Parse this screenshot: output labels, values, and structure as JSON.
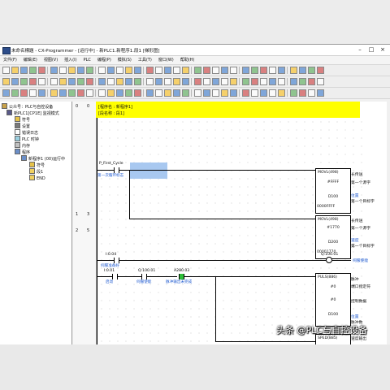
{
  "window": {
    "title": "未命名標題 - CX-Programmer - [运行中] - 新PLC1.新程序1.段1 [梯形图]"
  },
  "menu": [
    "文件(F)",
    "编辑(E)",
    "视图(V)",
    "插入(I)",
    "PLC",
    "编程(P)",
    "模拟(S)",
    "工具(T)",
    "窗口(W)",
    "帮助(H)"
  ],
  "tree": {
    "items": [
      "公众号：PLC与自控设备",
      "新PLC1[CP1E] 监视模式",
      "符号",
      "设置",
      "错误日志",
      "PLC 时钟",
      "内存",
      "程序",
      "新程序1 (00)运行中",
      "符号",
      "段1",
      "END"
    ]
  },
  "ladder": {
    "header": {
      "program_name": "[程序名 : 新程序1]",
      "section_name": "[段名称 : 段1]"
    },
    "rung_numbers": [
      "0",
      "0",
      "1",
      "3",
      "2",
      "5"
    ],
    "rung0": {
      "contact_op": "P_First_Cycle",
      "contact_comment": "第一次循环标志",
      "mov1": {
        "name": "MOVL(498)",
        "src": "#FFFF",
        "dst": "D100",
        "val": "0000FFFF"
      },
      "mov1_desc": [
        "长传送",
        "第一个源字",
        "位置",
        "第一个目标字"
      ],
      "mov2": {
        "name": "MOVL(498)",
        "src": "#1770",
        "dst": "D200",
        "val": "00001770"
      },
      "mov2_desc": [
        "长传送",
        "第一个源字",
        "速度",
        "第一个目标字"
      ]
    },
    "rung1": {
      "contact_op": "I:0.04",
      "contact_comment": "伺服准备好",
      "coil_op": "Q:100.01",
      "coil_comment": "伺服使能"
    },
    "rung2": {
      "c1_op": "I:0.01",
      "c1_comment": "启动",
      "c2_op": "Q:100.01",
      "c2_comment": "伺服使能",
      "c3_op": "A280.03",
      "c3_comment": "脉冲输出未完成",
      "puls": {
        "name": "PULS(886)",
        "p1": "#0",
        "p2": "#0",
        "p3": "D100"
      },
      "puls_desc": [
        "脉冲",
        "端口指定符",
        "控制数据",
        "位置",
        "脉冲数"
      ],
      "sped": {
        "name": "SPED(885)",
        "p1": "#0",
        "p2": "#0111",
        "p3": "D200",
        "val": "#6000.0"
      },
      "sped_desc": [
        "速度输出",
        "端口指定符",
        "输出模式",
        "目标频率"
      ]
    }
  },
  "watermark": "头条 @PLC与自控设备"
}
